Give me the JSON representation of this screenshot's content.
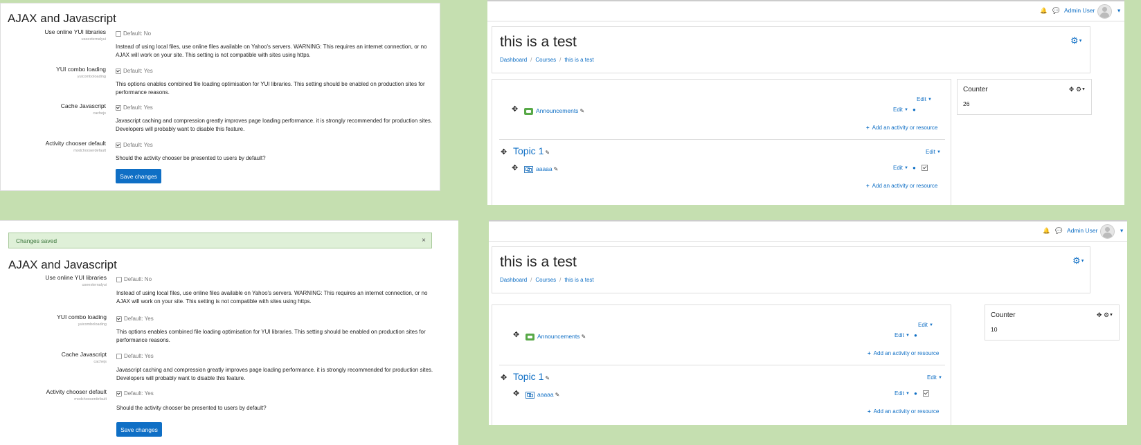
{
  "admin": {
    "title": "AJAX and Javascript",
    "alert_text": "Changes saved",
    "alert_close": "×",
    "settings": [
      {
        "label": "Use online YUI libraries",
        "name": "useexternalyui",
        "default": "Default: No",
        "desc1": "Instead of using local files, use online files available on Yahoo's servers. WARNING: This requires an internet connection, or no",
        "desc2": "AJAX will work on your site. This setting is not compatible with sites using https."
      },
      {
        "label": "YUI combo loading",
        "name": "yuicomboloading",
        "default": "Default: Yes",
        "desc1": "This options enables combined file loading optimisation for YUI libraries. This setting should be enabled on production sites for",
        "desc2": "performance reasons."
      },
      {
        "label": "Cache Javascript",
        "name": "cachejs",
        "default": "Default: Yes",
        "desc1": "Javascript caching and compression greatly improves page loading performance. it is strongly recommended for production sites.",
        "desc2": "Developers will probably want to disable this feature."
      },
      {
        "label": "Activity chooser default",
        "name": "modchooserdefault",
        "default": "Default: Yes",
        "desc1": "Should the activity chooser be presented to users by default?",
        "desc2": ""
      }
    ],
    "checked_before": [
      false,
      true,
      true,
      true
    ],
    "checked_after": [
      false,
      true,
      false,
      true
    ],
    "save_label": "Save changes"
  },
  "course": {
    "user_name": "Admin User",
    "title": "this is a test",
    "breadcrumb": [
      "Dashboard",
      "Courses",
      "this is a test"
    ],
    "announcements": "Announcements",
    "edit_label": "Edit",
    "add_activity": "Add an activity or resource",
    "topic": "Topic 1",
    "activity": "aaaaa",
    "block_title": "Counter",
    "counter_top": "26",
    "counter_bottom": "10"
  },
  "icons": [
    "bell-icon",
    "chat-icon",
    "user-avatar-icon",
    "gear-icon",
    "move-icon",
    "pencil-icon",
    "person-icon",
    "completion-checkbox-icon",
    "plus-icon",
    "forum-icon",
    "module-icon",
    "close-icon"
  ],
  "colors": {
    "link": "#0f6fc5",
    "background": "#c5dfb0",
    "alert_bg": "#dff0d8",
    "alert_text": "#3c763d"
  }
}
